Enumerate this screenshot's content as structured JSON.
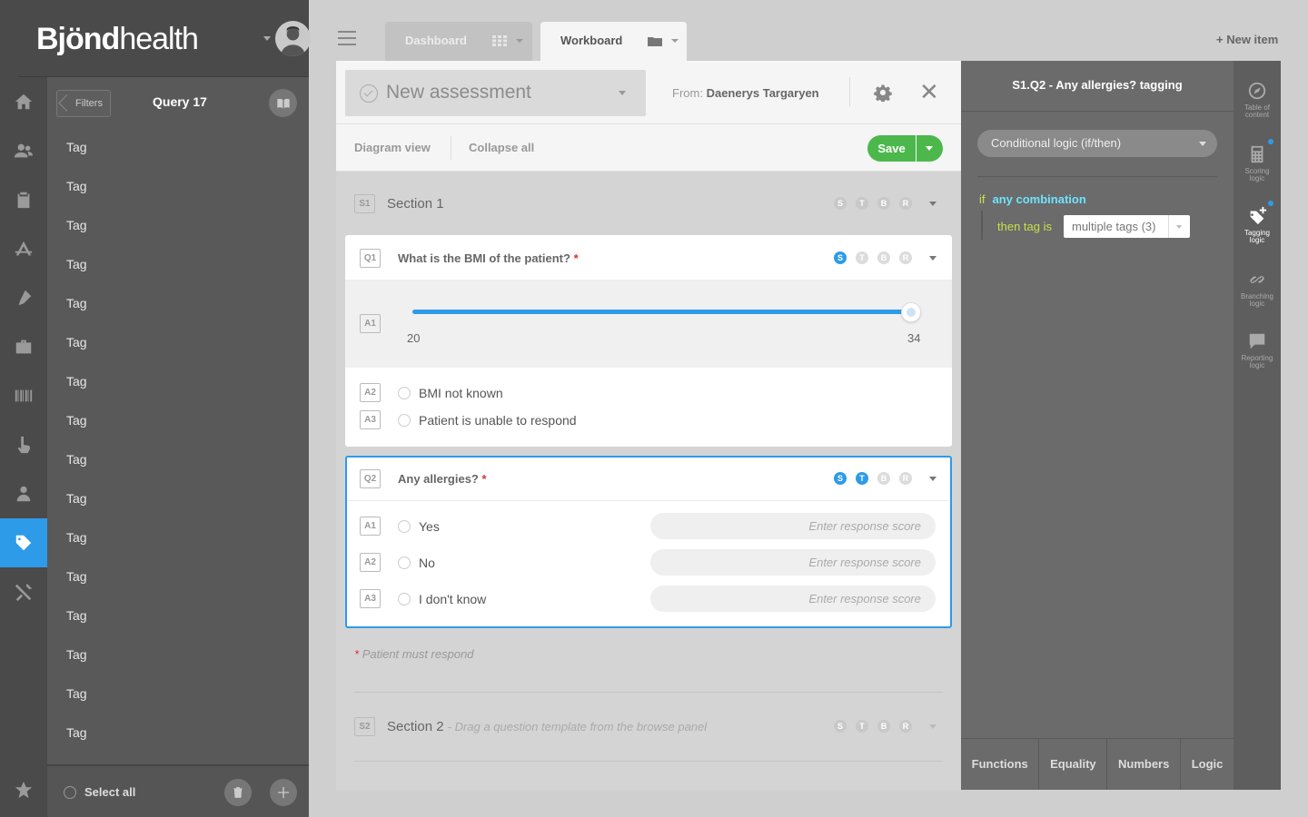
{
  "brand": {
    "logo_bold": "Bjönd",
    "logo_light": "health"
  },
  "panel": {
    "filters_label": "Filters",
    "query_title": "Query 17",
    "tags": [
      "Tag",
      "Tag",
      "Tag",
      "Tag",
      "Tag",
      "Tag",
      "Tag",
      "Tag",
      "Tag",
      "Tag",
      "Tag",
      "Tag",
      "Tag",
      "Tag",
      "Tag",
      "Tag"
    ],
    "select_all": "Select all"
  },
  "tabs": [
    {
      "label": "Dashboard",
      "active": false
    },
    {
      "label": "Workboard",
      "active": true
    }
  ],
  "new_item": "+ New item",
  "editor": {
    "assessment_title": "New assessment",
    "from_label": "From:",
    "from_name": "Daenerys Targaryen",
    "diagram_view": "Diagram view",
    "collapse_all": "Collapse all",
    "save_label": "Save",
    "section1": {
      "badge": "S1",
      "title": "Section 1"
    },
    "flags": [
      "S",
      "T",
      "B",
      "R"
    ],
    "q1": {
      "badge": "Q1",
      "title": "What is the BMI of the patient?",
      "required_mark": "*",
      "slider": {
        "badge": "A1",
        "min": "20",
        "max": "34",
        "value_fraction": 1.0
      },
      "answers": [
        {
          "badge": "A2",
          "label": "BMI not known"
        },
        {
          "badge": "A3",
          "label": "Patient is unable to respond"
        }
      ]
    },
    "q2": {
      "badge": "Q2",
      "title": "Any allergies?",
      "required_mark": "*",
      "score_placeholder": "Enter response score",
      "answers": [
        {
          "badge": "A1",
          "label": "Yes"
        },
        {
          "badge": "A2",
          "label": "No"
        },
        {
          "badge": "A3",
          "label": "I don't know"
        }
      ]
    },
    "note_mark": "*",
    "note": "Patient must respond",
    "section2": {
      "badge": "S2",
      "title": "Section 2",
      "subtitle": "- Drag a question template from the browse panel"
    }
  },
  "logic": {
    "title": "S1.Q2 - Any allergies? tagging",
    "conditional": "Conditional logic (if/then)",
    "if_kw": "if",
    "combination": "any combination",
    "then_kw": "then tag is",
    "tags_value": "multiple tags (3)",
    "footer": [
      "Functions",
      "Equality",
      "Numbers",
      "Logic"
    ]
  },
  "side_tools": [
    {
      "label1": "Table of",
      "label2": "content"
    },
    {
      "label1": "Scoring",
      "label2": "logic"
    },
    {
      "label1": "Tagging",
      "label2": "logic"
    },
    {
      "label1": "Branching",
      "label2": "logic"
    },
    {
      "label1": "Reporting",
      "label2": "logic"
    }
  ],
  "colors": {
    "accent": "#2e9be8",
    "save": "#4cb84c",
    "logic_if": "#c8e04a",
    "logic_comb": "#6ee3ff"
  }
}
